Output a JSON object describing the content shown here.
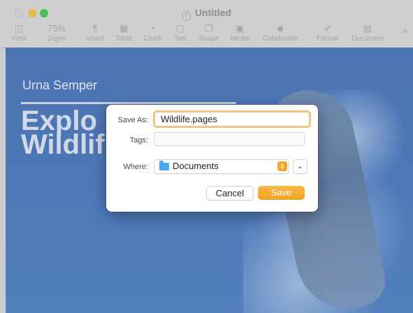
{
  "window": {
    "title": "Untitled"
  },
  "toolbar": {
    "items": [
      {
        "label": "View",
        "icon": "sidebar-icon"
      },
      {
        "label": "Zoom",
        "value": "75%",
        "icon": "zoom-dropdown"
      },
      {
        "label": "Insert",
        "icon": "paragraph-icon"
      },
      {
        "label": "Table",
        "icon": "table-icon"
      },
      {
        "label": "Chart",
        "icon": "chart-icon"
      },
      {
        "label": "Text",
        "icon": "text-box-icon"
      },
      {
        "label": "Shape",
        "icon": "shape-icon"
      },
      {
        "label": "Media",
        "icon": "media-icon"
      },
      {
        "label": "Collaborate",
        "icon": "collaborate-icon"
      },
      {
        "label": "Format",
        "icon": "format-brush-icon"
      },
      {
        "label": "Document",
        "icon": "document-icon"
      }
    ],
    "more_icon": "chevron-double-right-icon"
  },
  "document": {
    "author": "Urna Semper",
    "headline_line1": "Explo",
    "headline_line2": "Wildlif"
  },
  "save_dialog": {
    "save_as_label": "Save As:",
    "filename": "Wildlife.pages",
    "tags_label": "Tags:",
    "tags_value": "",
    "where_label": "Where:",
    "where_value": "Documents",
    "cancel_label": "Cancel",
    "save_label": "Save",
    "accent_color": "#f2a324"
  }
}
